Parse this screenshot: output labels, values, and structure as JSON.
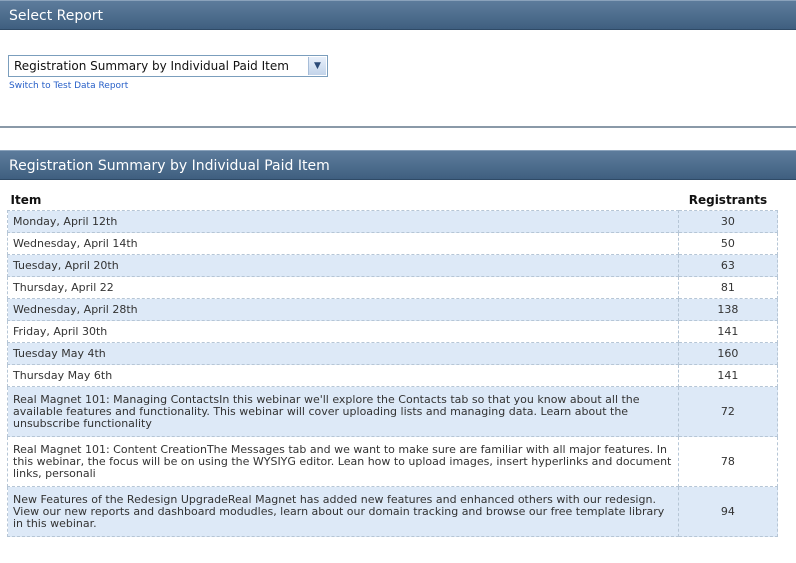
{
  "select_panel": {
    "title": "Select Report",
    "report_select_value": "Registration Summary by Individual Paid Item",
    "switch_link": "Switch to Test Data Report"
  },
  "report_panel": {
    "title": "Registration Summary by Individual Paid Item",
    "columns": [
      "Item",
      "Registrants"
    ],
    "rows": [
      {
        "item": "Monday, April 12th",
        "registrants": "30"
      },
      {
        "item": "Wednesday, April 14th",
        "registrants": "50"
      },
      {
        "item": "Tuesday, April 20th",
        "registrants": "63"
      },
      {
        "item": "Thursday, April 22",
        "registrants": "81"
      },
      {
        "item": "Wednesday, April 28th",
        "registrants": "138"
      },
      {
        "item": "Friday, April 30th",
        "registrants": "141"
      },
      {
        "item": "Tuesday May 4th",
        "registrants": "160"
      },
      {
        "item": "Thursday May 6th",
        "registrants": "141"
      },
      {
        "item": "Real Magnet 101: Managing ContactsIn this webinar we'll explore the Contacts tab so that you know about all the available features and functionality. This webinar will cover uploading lists and managing data. Learn about the unsubscribe functionality",
        "registrants": "72"
      },
      {
        "item": "Real Magnet 101: Content CreationThe Messages tab and we want to make sure are familiar with all major features. In this webinar, the focus will be on using the WYSIYG editor. Lean how to upload images, insert hyperlinks and document links, personali",
        "registrants": "78"
      },
      {
        "item": "New Features of the Redesign UpgradeReal Magnet has added new features and enhanced others with our redesign. View our new reports and dashboard modudles, learn about our domain tracking and browse our free template library in this webinar.",
        "registrants": "94"
      }
    ]
  }
}
